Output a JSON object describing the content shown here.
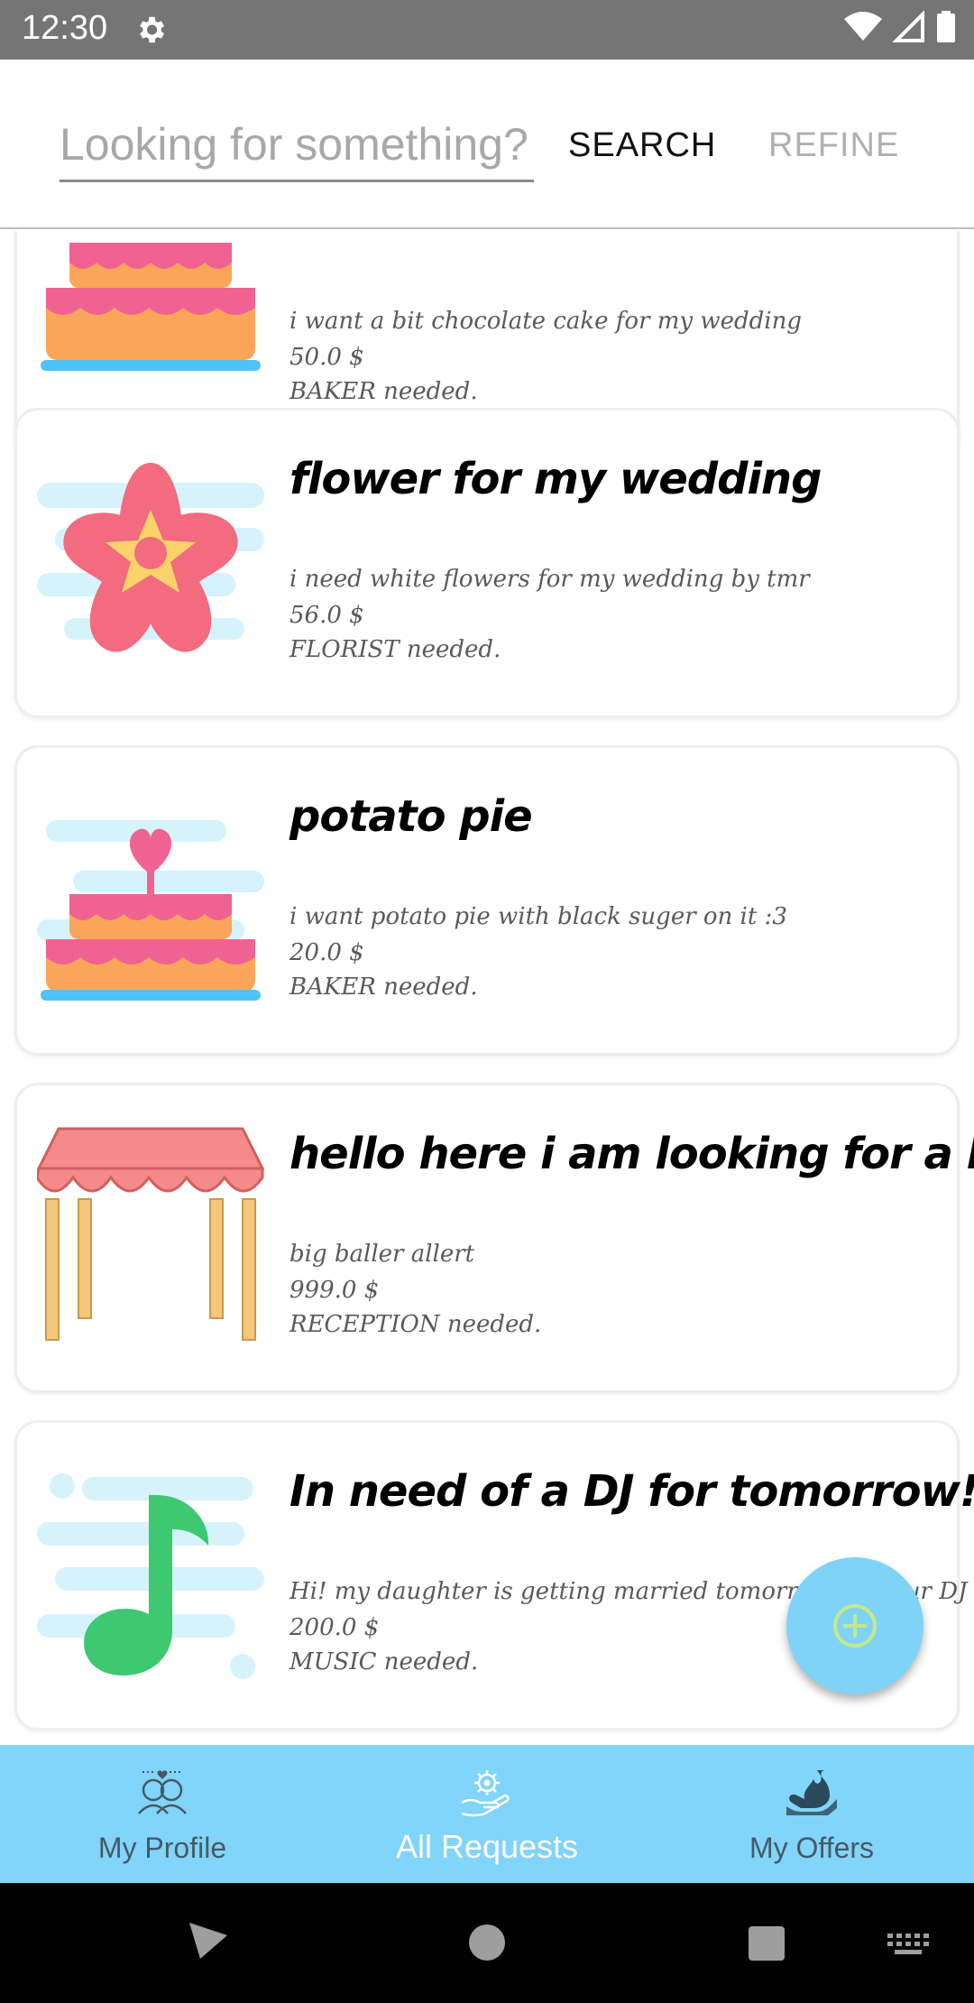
{
  "status_bar": {
    "time": "12:30"
  },
  "search": {
    "placeholder": "Looking for something?",
    "search_label": "SEARCH",
    "refine_label": "REFINE"
  },
  "requests": [
    {
      "title": "",
      "description": "i want a bit chocolate  cake for my wedding",
      "price": "50.0 $",
      "needed": "BAKER needed.",
      "icon": "cake-icon"
    },
    {
      "title": "flower for my wedding",
      "description": "i need white flowers for my wedding by tmr",
      "price": "56.0 $",
      "needed": "FLORIST needed.",
      "icon": "flower-icon"
    },
    {
      "title": "potato pie",
      "description": "i want potato pie with black suger on it :3",
      "price": "20.0 $",
      "needed": "BAKER needed.",
      "icon": "cake-icon"
    },
    {
      "title": "hello here i am looking for a baller",
      "description": "big baller allert",
      "price": "999.0 $",
      "needed": "RECEPTION needed.",
      "icon": "canopy-icon"
    },
    {
      "title": "In need of a DJ for tomorrow!!!",
      "description": "Hi! my daughter is getting married tomorrow and our DJ",
      "price": "200.0 $",
      "needed": "MUSIC needed.",
      "icon": "music-note-icon"
    }
  ],
  "bottom_nav": [
    {
      "label": "My Profile",
      "icon": "couple-icon",
      "active": false
    },
    {
      "label": "All Requests",
      "icon": "hand-gear-icon",
      "active": true
    },
    {
      "label": "My Offers",
      "icon": "hand-offer-icon",
      "active": false
    }
  ],
  "colors": {
    "accent": "#81d4fa",
    "fab": "#7fd3f7",
    "status_bar": "#757575"
  }
}
